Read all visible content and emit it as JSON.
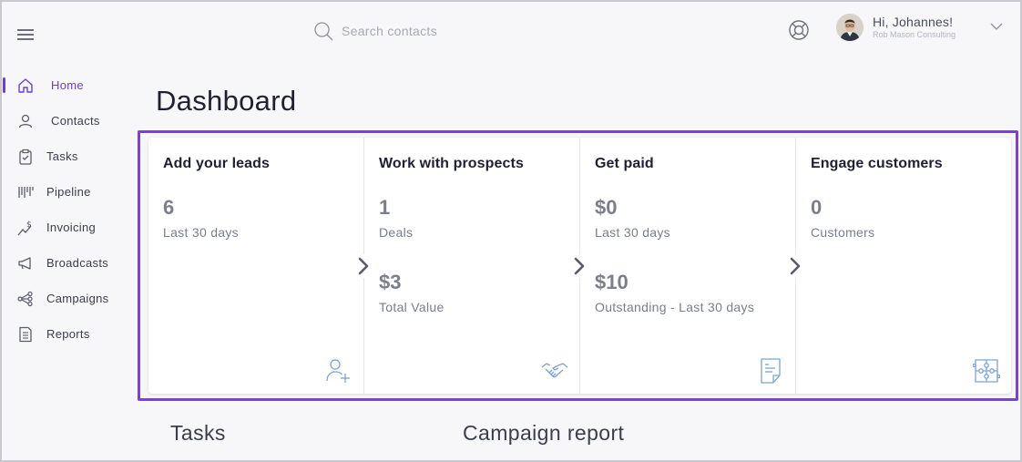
{
  "header": {
    "search": {
      "placeholder": "Search contacts",
      "value": ""
    },
    "user": {
      "greeting": "Hi, Johannes!",
      "company": "Rob Mason Consulting"
    }
  },
  "sidebar": {
    "items": [
      {
        "label": "Home",
        "icon": "home-icon",
        "active": true
      },
      {
        "label": "Contacts",
        "icon": "contacts-icon"
      },
      {
        "label": "Tasks",
        "icon": "tasks-icon"
      },
      {
        "label": "Pipeline",
        "icon": "pipeline-icon"
      },
      {
        "label": "Invoicing",
        "icon": "invoicing-icon"
      },
      {
        "label": "Broadcasts",
        "icon": "megaphone-icon"
      },
      {
        "label": "Campaigns",
        "icon": "campaigns-icon"
      },
      {
        "label": "Reports",
        "icon": "reports-icon"
      }
    ]
  },
  "main": {
    "title": "Dashboard",
    "cards": [
      {
        "title": "Add your leads",
        "stats": [
          {
            "value": "6",
            "label": "Last 30 days"
          }
        ],
        "icon": "add-user-icon"
      },
      {
        "title": "Work with prospects",
        "stats": [
          {
            "value": "1",
            "label": "Deals"
          },
          {
            "value": "$3",
            "label": "Total Value"
          }
        ],
        "icon": "handshake-icon"
      },
      {
        "title": "Get paid",
        "stats": [
          {
            "value": "$0",
            "label": "Last 30 days"
          },
          {
            "value": "$10",
            "label": "Outstanding - Last 30 days"
          }
        ],
        "icon": "invoice-icon"
      },
      {
        "title": "Engage customers",
        "stats": [
          {
            "value": "0",
            "label": "Customers"
          }
        ],
        "icon": "puzzle-icon"
      }
    ],
    "sections": {
      "tasks": "Tasks",
      "campaign_report": "Campaign report"
    }
  },
  "colors": {
    "accent": "#6a3ce8",
    "highlight": "#7b3fe0",
    "icon_blue": "#7aa3d6",
    "muted": "#7b7e8c"
  }
}
